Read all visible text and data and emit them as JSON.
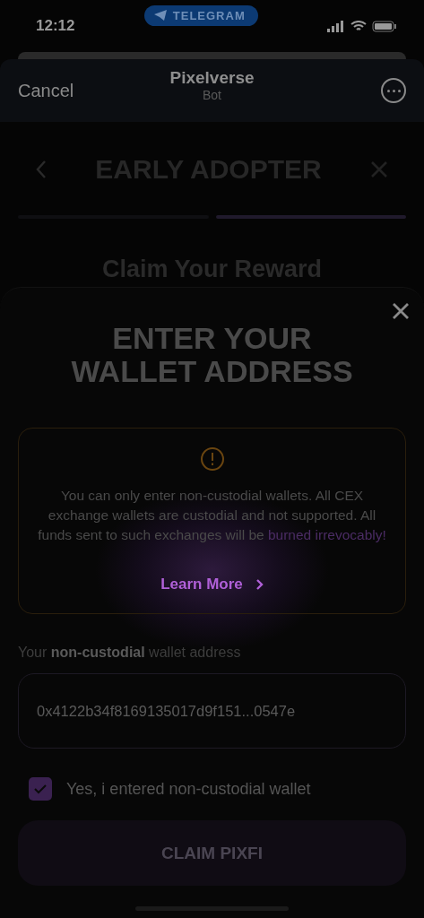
{
  "status_bar": {
    "time": "12:12",
    "pill": "TELEGRAM"
  },
  "header": {
    "cancel": "Cancel",
    "title": "Pixelverse",
    "subtitle": "Bot"
  },
  "page": {
    "title": "EARLY ADOPTER",
    "steps": [
      {
        "active": false
      },
      {
        "active": true
      }
    ],
    "heading": "Claim Your Reward"
  },
  "sheet": {
    "title_lines": [
      "ENTER YOUR",
      "WALLET ADDRESS"
    ],
    "warning": {
      "text": "You can only enter non-custodial wallets. All CEX exchange wallets are custodial and not supported. All funds sent to such exchanges will be ",
      "highlight": "burned irrevocably!",
      "link": "Learn More"
    },
    "field_label": "Your **non-custodial** wallet address",
    "field_value": "0x4122b34f8169135017d9f151...0547e",
    "confirm": {
      "label": "Yes, i entered non-custodial wallet",
      "checked": true
    },
    "button": {
      "label": "CLAIM PIXFI",
      "disabled": true
    }
  }
}
